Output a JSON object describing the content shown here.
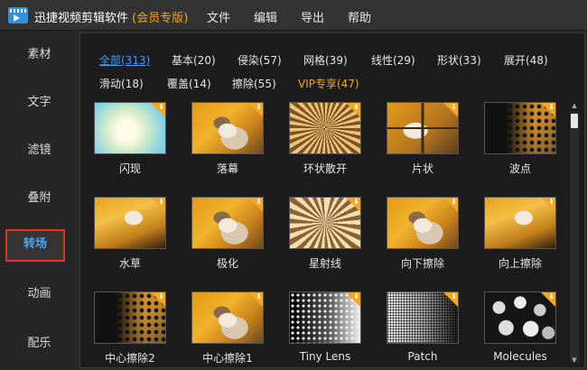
{
  "app": {
    "title": "迅捷视频剪辑软件",
    "edition": "(会员专版)"
  },
  "menu": [
    "文件",
    "编辑",
    "导出",
    "帮助"
  ],
  "sidebar": {
    "items": [
      {
        "label": "素材",
        "active": false
      },
      {
        "label": "文字",
        "active": false
      },
      {
        "label": "滤镜",
        "active": false
      },
      {
        "label": "叠附",
        "active": false
      },
      {
        "label": "转场",
        "active": true
      },
      {
        "label": "动画",
        "active": false
      },
      {
        "label": "配乐",
        "active": false
      }
    ]
  },
  "filters": [
    {
      "label": "全部(313)",
      "active": true
    },
    {
      "label": "基本(20)"
    },
    {
      "label": "侵染(57)"
    },
    {
      "label": "网格(39)"
    },
    {
      "label": "线性(29)"
    },
    {
      "label": "形状(33)"
    },
    {
      "label": "展开(48)"
    },
    {
      "label": "滑动(18)"
    },
    {
      "label": "覆盖(14)"
    },
    {
      "label": "擦除(55)"
    },
    {
      "label": "VIP专享(47)",
      "vip": true
    }
  ],
  "transitions": [
    {
      "label": "闪现",
      "icon": "download-icon"
    },
    {
      "label": "落幕",
      "icon": "download-icon"
    },
    {
      "label": "环状散开",
      "icon": "download-icon"
    },
    {
      "label": "片状",
      "icon": "download-icon"
    },
    {
      "label": "波点",
      "icon": "download-icon"
    },
    {
      "label": "水草",
      "icon": "download-icon"
    },
    {
      "label": "极化",
      "icon": "download-icon"
    },
    {
      "label": "星射线",
      "icon": "download-icon"
    },
    {
      "label": "向下擦除",
      "icon": "download-icon"
    },
    {
      "label": "向上擦除",
      "icon": "download-icon"
    },
    {
      "label": "中心擦除2",
      "icon": "download-icon"
    },
    {
      "label": "中心擦除1",
      "icon": "download-icon"
    },
    {
      "label": "Tiny Lens",
      "icon": "download-icon"
    },
    {
      "label": "Patch",
      "icon": "download-icon"
    },
    {
      "label": "Molecules",
      "icon": "download-icon"
    }
  ],
  "colors": {
    "accent": "#3f9bff",
    "vip": "#f0a81c",
    "highlight_border": "#e0322d",
    "download_badge": "#f5a623"
  }
}
